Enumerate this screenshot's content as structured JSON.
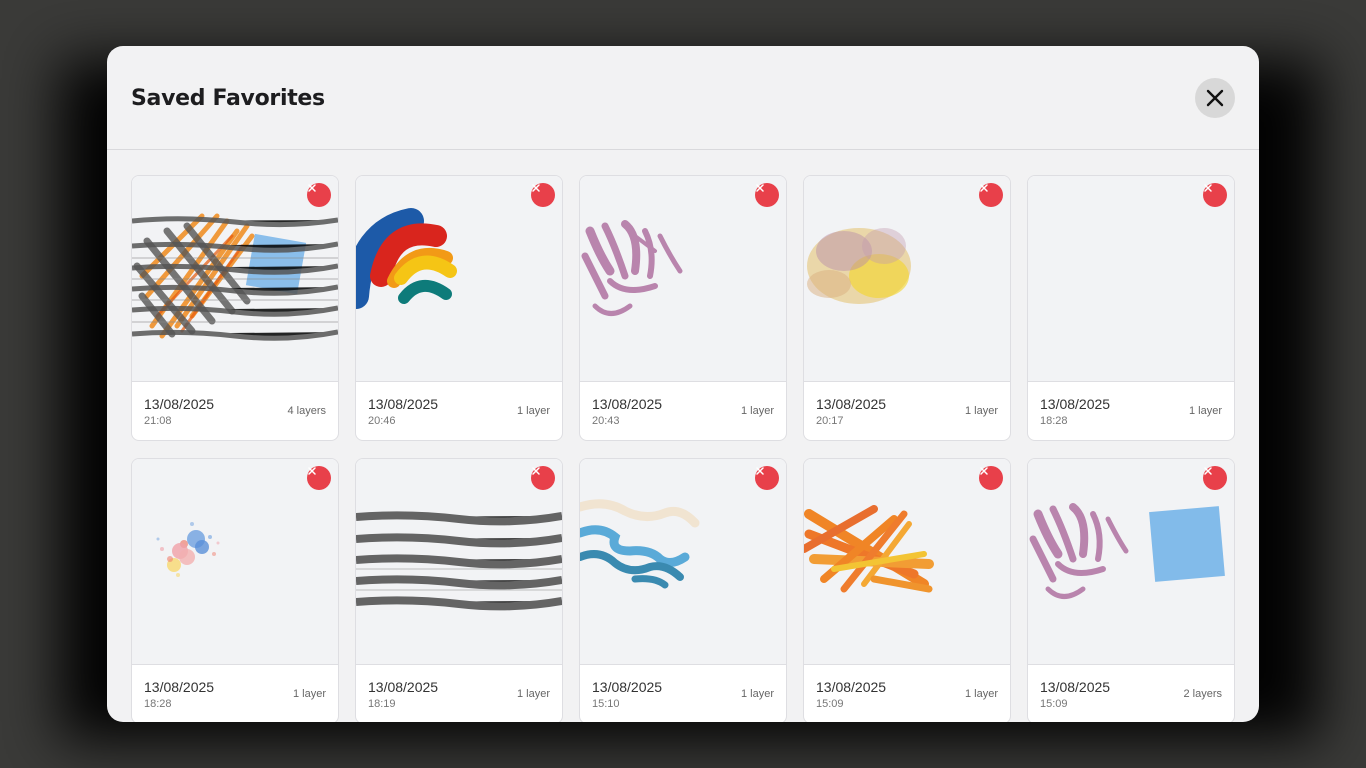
{
  "modal": {
    "title": "Saved Favorites",
    "close_icon": "close-icon",
    "delete_icon": "remove-icon",
    "accent_delete": "#e8404a"
  },
  "favorites": [
    {
      "date": "13/08/2025",
      "time": "21:08",
      "layers": "4 layers",
      "preview": "stripes-cross-orange-blue"
    },
    {
      "date": "13/08/2025",
      "time": "20:46",
      "layers": "1 layer",
      "preview": "rainbow-arcs"
    },
    {
      "date": "13/08/2025",
      "time": "20:43",
      "layers": "1 layer",
      "preview": "purple-strokes"
    },
    {
      "date": "13/08/2025",
      "time": "20:17",
      "layers": "1 layer",
      "preview": "yellow-purple-wash"
    },
    {
      "date": "13/08/2025",
      "time": "18:28",
      "layers": "1 layer",
      "preview": "empty"
    },
    {
      "date": "13/08/2025",
      "time": "18:28",
      "layers": "1 layer",
      "preview": "confetti-dots"
    },
    {
      "date": "13/08/2025",
      "time": "18:19",
      "layers": "1 layer",
      "preview": "gray-stripes"
    },
    {
      "date": "13/08/2025",
      "time": "15:10",
      "layers": "1 layer",
      "preview": "blue-waves"
    },
    {
      "date": "13/08/2025",
      "time": "15:09",
      "layers": "1 layer",
      "preview": "orange-hatch"
    },
    {
      "date": "13/08/2025",
      "time": "15:09",
      "layers": "2 layers",
      "preview": "purple-and-blue-square"
    }
  ]
}
